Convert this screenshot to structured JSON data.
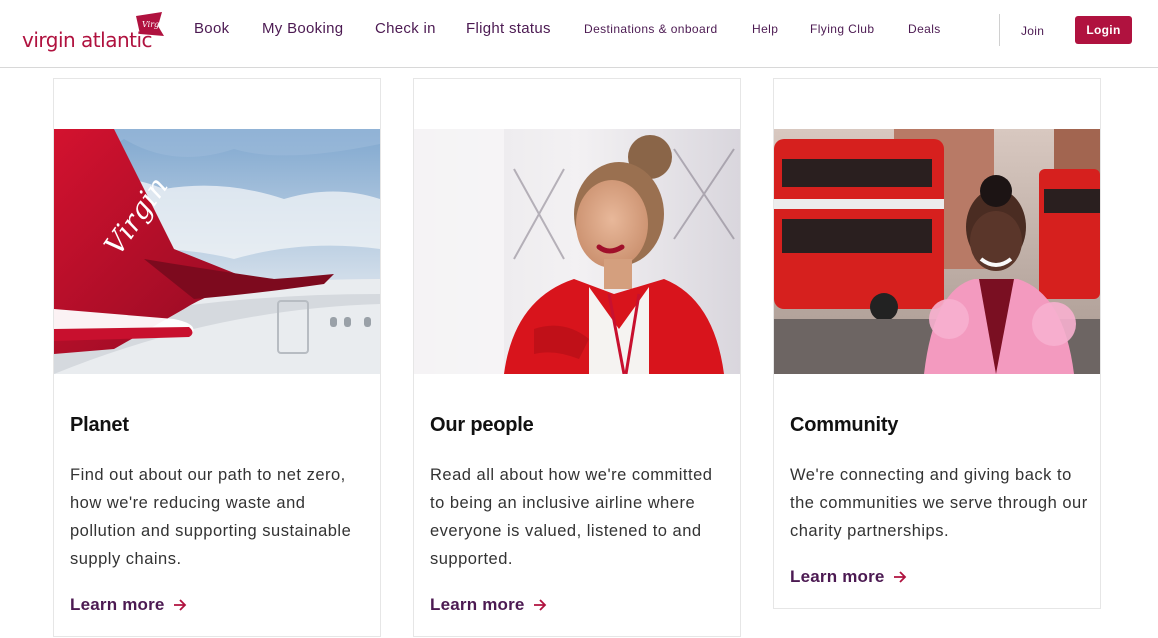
{
  "brand": {
    "logo_text": "virgin atlantic",
    "flag_text": "Virgin",
    "color_primary": "#b0123f",
    "color_nav": "#4c1a52"
  },
  "nav": {
    "items": [
      {
        "label": "Book"
      },
      {
        "label": "My Booking"
      },
      {
        "label": "Check in"
      },
      {
        "label": "Flight status"
      },
      {
        "label": "Destinations & onboard"
      },
      {
        "label": "Help"
      },
      {
        "label": "Flying Club"
      },
      {
        "label": "Deals"
      }
    ],
    "join_label": "Join",
    "login_label": "Login"
  },
  "cards": [
    {
      "title": "Planet",
      "body": "Find out about our path to net zero, how we're reducing waste and pollution and supporting sustainable supply chains.",
      "link": "Learn more",
      "image": "aircraft-tail-virgin-logo"
    },
    {
      "title": "Our people",
      "body": "Read all about how we're committed to being an inclusive airline where everyone is valued, listened to and supported.",
      "link": "Learn more",
      "image": "cabin-crew-member-red-uniform"
    },
    {
      "title": "Community",
      "body": "We're connecting and giving back to the communities we serve through our charity partnerships.",
      "link": "Learn more",
      "image": "woman-pink-coat-red-buses"
    }
  ]
}
